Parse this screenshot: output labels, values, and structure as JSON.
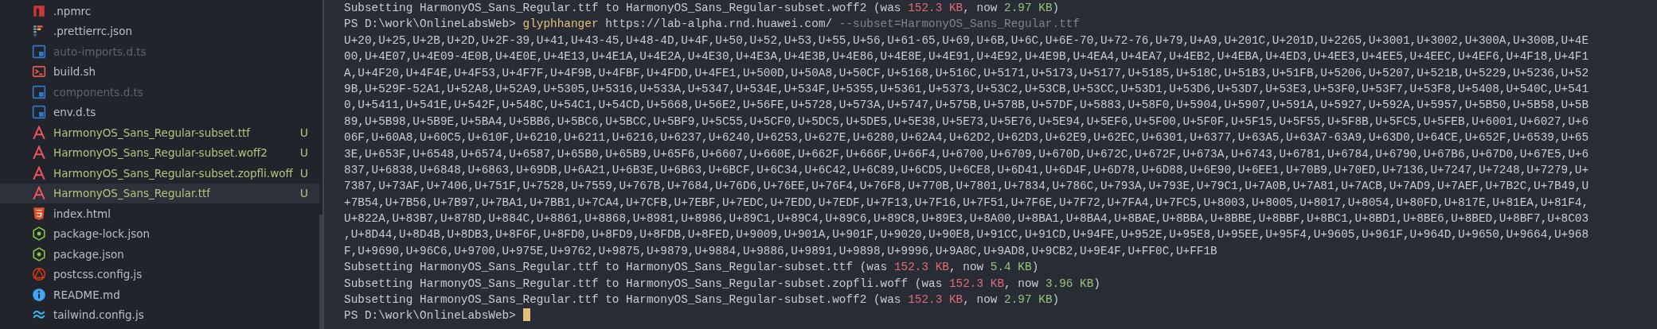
{
  "explorer": {
    "items": [
      {
        "name": ".npmrc",
        "kind": "npm",
        "dimmed": false,
        "untracked": false,
        "selected": false
      },
      {
        "name": ".prettierrc.json",
        "kind": "prettier",
        "dimmed": false,
        "untracked": false,
        "selected": false
      },
      {
        "name": "auto-imports.d.ts",
        "kind": "ts",
        "dimmed": true,
        "untracked": false,
        "selected": false
      },
      {
        "name": "build.sh",
        "kind": "shell",
        "dimmed": false,
        "untracked": false,
        "selected": false
      },
      {
        "name": "components.d.ts",
        "kind": "ts",
        "dimmed": true,
        "untracked": false,
        "selected": false
      },
      {
        "name": "env.d.ts",
        "kind": "ts",
        "dimmed": false,
        "untracked": false,
        "selected": false
      },
      {
        "name": "HarmonyOS_Sans_Regular-subset.ttf",
        "kind": "font",
        "status": "U",
        "dimmed": false,
        "untracked": true,
        "selected": false
      },
      {
        "name": "HarmonyOS_Sans_Regular-subset.woff2",
        "kind": "font",
        "status": "U",
        "dimmed": false,
        "untracked": true,
        "selected": false
      },
      {
        "name": "HarmonyOS_Sans_Regular-subset.zopfli.woff",
        "kind": "font",
        "status": "U",
        "dimmed": false,
        "untracked": true,
        "selected": false
      },
      {
        "name": "HarmonyOS_Sans_Regular.ttf",
        "kind": "font",
        "status": "U",
        "dimmed": false,
        "untracked": true,
        "selected": true
      },
      {
        "name": "index.html",
        "kind": "html",
        "dimmed": false,
        "untracked": false,
        "selected": false
      },
      {
        "name": "package-lock.json",
        "kind": "node",
        "dimmed": false,
        "untracked": false,
        "selected": false
      },
      {
        "name": "package.json",
        "kind": "node",
        "dimmed": false,
        "untracked": false,
        "selected": false
      },
      {
        "name": "postcss.config.js",
        "kind": "postcss",
        "dimmed": false,
        "untracked": false,
        "selected": false
      },
      {
        "name": "README.md",
        "kind": "info",
        "dimmed": false,
        "untracked": false,
        "selected": false
      },
      {
        "name": "tailwind.config.js",
        "kind": "tailwind",
        "dimmed": false,
        "untracked": false,
        "selected": false
      }
    ]
  },
  "terminal": {
    "lines": [
      {
        "segments": [
          {
            "text": "Subsetting HarmonyOS_Sans_Regular.ttf to HarmonyOS_Sans_Regular-subset.woff2 (was ",
            "kind": "plain"
          },
          {
            "text": "152.3 KB",
            "kind": "red"
          },
          {
            "text": ", now ",
            "kind": "plain"
          },
          {
            "text": "2.97 KB",
            "kind": "green"
          },
          {
            "text": ")",
            "kind": "plain"
          }
        ]
      },
      {
        "segments": [
          {
            "text": "PS D:\\work\\OnlineLabsWeb> ",
            "kind": "plain"
          },
          {
            "text": "glyphhanger",
            "kind": "yellow"
          },
          {
            "text": " https://lab-alpha.rnd.huawei.com/ ",
            "kind": "plain"
          },
          {
            "text": "--subset=HarmonyOS_Sans_Regular.ttf",
            "kind": "dim"
          }
        ]
      },
      {
        "segments": [
          {
            "text": "U+20,U+25,U+2B,U+2D,U+2F-39,U+41,U+43-45,U+48-4D,U+4F,U+50,U+52,U+53,U+55,U+56,U+61-65,U+69,U+6B,U+6C,U+6E-70,U+72-76,U+79,U+A9,U+201C,U+201D,U+2265,U+3001,U+3002,U+300A,U+300B,U+4E",
            "kind": "plain"
          }
        ]
      },
      {
        "segments": [
          {
            "text": "00,U+4E07,U+4E09-4E0B,U+4E0E,U+4E13,U+4E1A,U+4E2A,U+4E30,U+4E3A,U+4E3B,U+4E86,U+4E8E,U+4E91,U+4E92,U+4E9B,U+4EA4,U+4EA7,U+4EB2,U+4EBA,U+4ED3,U+4EE3,U+4EE5,U+4EEC,U+4EF6,U+4F18,U+4F1",
            "kind": "plain"
          }
        ]
      },
      {
        "segments": [
          {
            "text": "A,U+4F20,U+4F4E,U+4F53,U+4F7F,U+4F9B,U+4FBF,U+4FDD,U+4FE1,U+500D,U+50A8,U+50CF,U+5168,U+516C,U+5171,U+5173,U+5177,U+5185,U+518C,U+51B3,U+51FB,U+5206,U+5207,U+521B,U+5229,U+5236,U+52",
            "kind": "plain"
          }
        ]
      },
      {
        "segments": [
          {
            "text": "9B,U+529F-52A1,U+52A8,U+52A9,U+5305,U+5316,U+533A,U+5347,U+534E,U+534F,U+5355,U+5361,U+5373,U+53C2,U+53CB,U+53CC,U+53D1,U+53D6,U+53D7,U+53E3,U+53F0,U+53F7,U+53F8,U+5408,U+540C,U+541",
            "kind": "plain"
          }
        ]
      },
      {
        "segments": [
          {
            "text": "0,U+5411,U+541E,U+542F,U+548C,U+54C1,U+54CD,U+5668,U+56E2,U+56FE,U+5728,U+573A,U+5747,U+575B,U+578B,U+57DF,U+5883,U+58F0,U+5904,U+5907,U+591A,U+5927,U+592A,U+5957,U+5B50,U+5B58,U+5B",
            "kind": "plain"
          }
        ]
      },
      {
        "segments": [
          {
            "text": "89,U+5B98,U+5B9E,U+5BA4,U+5BB6,U+5BC6,U+5BCC,U+5BF9,U+5C55,U+5CF0,U+5DC5,U+5DE5,U+5E38,U+5E73,U+5E76,U+5E94,U+5EF6,U+5F00,U+5F0F,U+5F15,U+5F55,U+5F8B,U+5FC5,U+5FEB,U+6001,U+6027,U+6",
            "kind": "plain"
          }
        ]
      },
      {
        "segments": [
          {
            "text": "06F,U+60A8,U+60C5,U+610F,U+6210,U+6211,U+6216,U+6237,U+6240,U+6253,U+627E,U+6280,U+62A4,U+62D2,U+62D3,U+62E9,U+62EC,U+6301,U+6377,U+63A5,U+63A7-63A9,U+63D0,U+64CE,U+652F,U+6539,U+65",
            "kind": "plain"
          }
        ]
      },
      {
        "segments": [
          {
            "text": "3E,U+653F,U+6548,U+6574,U+6587,U+65B0,U+65B9,U+65F6,U+6607,U+660E,U+662F,U+666F,U+66F4,U+6700,U+6709,U+670D,U+672C,U+672F,U+673A,U+6743,U+6781,U+6784,U+6790,U+67B6,U+67D0,U+67E5,U+6",
            "kind": "plain"
          }
        ]
      },
      {
        "segments": [
          {
            "text": "837,U+6838,U+6848,U+6863,U+69DB,U+6A21,U+6B3E,U+6B63,U+6BCF,U+6C34,U+6C42,U+6C89,U+6CD5,U+6CE8,U+6D41,U+6D4F,U+6D78,U+6D88,U+6E90,U+6EE1,U+70B9,U+70ED,U+7136,U+7247,U+7248,U+7279,U+",
            "kind": "plain"
          }
        ]
      },
      {
        "segments": [
          {
            "text": "7387,U+73AF,U+7406,U+751F,U+7528,U+7559,U+767B,U+7684,U+76D6,U+76EE,U+76F4,U+76F8,U+770B,U+7801,U+7834,U+786C,U+793A,U+793E,U+79C1,U+7A0B,U+7A81,U+7ACB,U+7AD9,U+7AEF,U+7B2C,U+7B49,U",
            "kind": "plain"
          }
        ]
      },
      {
        "segments": [
          {
            "text": "+7B54,U+7B56,U+7B97,U+7BA1,U+7BB1,U+7CA4,U+7CFB,U+7EBF,U+7EDC,U+7EDD,U+7EDF,U+7F13,U+7F16,U+7F51,U+7F6E,U+7F72,U+7FA4,U+7FC5,U+8003,U+8005,U+8017,U+8054,U+80FD,U+817E,U+81EA,U+81F4,",
            "kind": "plain"
          }
        ]
      },
      {
        "segments": [
          {
            "text": "U+822A,U+83B7,U+878D,U+884C,U+8861,U+8868,U+8981,U+8986,U+89C1,U+89C4,U+89C6,U+89C8,U+89E3,U+8A00,U+8BA1,U+8BA4,U+8BAE,U+8BBA,U+8BBE,U+8BBF,U+8BC1,U+8BD1,U+8BE6,U+8BED,U+8BF7,U+8C03",
            "kind": "plain"
          }
        ]
      },
      {
        "segments": [
          {
            "text": ",U+8D44,U+8D4B,U+8DB3,U+8F6F,U+8FD0,U+8FD9,U+8FDB,U+8FED,U+9009,U+901A,U+901F,U+9020,U+90E8,U+91CC,U+91CD,U+94FE,U+952E,U+95E8,U+95EE,U+95F4,U+9605,U+961F,U+964D,U+9650,U+9664,U+968",
            "kind": "plain"
          }
        ]
      },
      {
        "segments": [
          {
            "text": "F,U+9690,U+96C6,U+9700,U+975E,U+9762,U+9875,U+9879,U+9884,U+9886,U+9891,U+9898,U+9996,U+9A8C,U+9AD8,U+9CB2,U+9E4F,U+FF0C,U+FF1B",
            "kind": "plain"
          }
        ]
      },
      {
        "segments": [
          {
            "text": "Subsetting HarmonyOS_Sans_Regular.ttf to HarmonyOS_Sans_Regular-subset.ttf (was ",
            "kind": "plain"
          },
          {
            "text": "152.3 KB",
            "kind": "red"
          },
          {
            "text": ", now ",
            "kind": "plain"
          },
          {
            "text": "5.4 KB",
            "kind": "green"
          },
          {
            "text": ")",
            "kind": "plain"
          }
        ]
      },
      {
        "segments": [
          {
            "text": "Subsetting HarmonyOS_Sans_Regular.ttf to HarmonyOS_Sans_Regular-subset.zopfli.woff (was ",
            "kind": "plain"
          },
          {
            "text": "152.3 KB",
            "kind": "red"
          },
          {
            "text": ", now ",
            "kind": "plain"
          },
          {
            "text": "3.96 KB",
            "kind": "green"
          },
          {
            "text": ")",
            "kind": "plain"
          }
        ]
      },
      {
        "segments": [
          {
            "text": "Subsetting HarmonyOS_Sans_Regular.ttf to HarmonyOS_Sans_Regular-subset.woff2 (was ",
            "kind": "plain"
          },
          {
            "text": "152.3 KB",
            "kind": "red"
          },
          {
            "text": ", now ",
            "kind": "plain"
          },
          {
            "text": "2.97 KB",
            "kind": "green"
          },
          {
            "text": ")",
            "kind": "plain"
          }
        ]
      },
      {
        "segments": [
          {
            "text": "PS D:\\work\\OnlineLabsWeb>",
            "kind": "plain"
          }
        ],
        "cursor": true
      }
    ]
  }
}
